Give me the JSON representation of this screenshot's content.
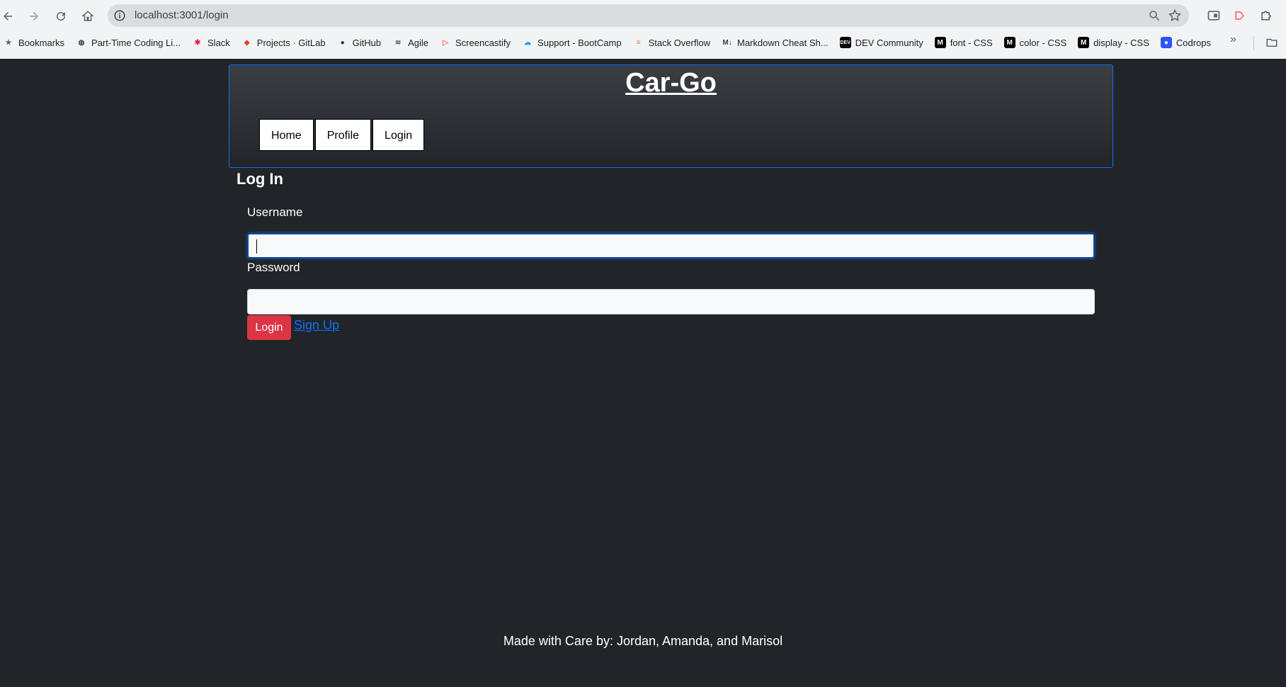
{
  "browser": {
    "url": "localhost:3001/login",
    "bookmarks": [
      {
        "label": "Bookmarks",
        "icon": "star-icon"
      },
      {
        "label": "Part-Time Coding Li...",
        "icon": "globe-icon"
      },
      {
        "label": "Slack",
        "icon": "slack-icon"
      },
      {
        "label": "Projects · GitLab",
        "icon": "gitlab-icon"
      },
      {
        "label": "GitHub",
        "icon": "github-icon"
      },
      {
        "label": "Agile",
        "icon": "agile-icon"
      },
      {
        "label": "Screencastify",
        "icon": "screencastify-icon"
      },
      {
        "label": "Support - BootCamp",
        "icon": "salesforce-icon"
      },
      {
        "label": "Stack Overflow",
        "icon": "stackoverflow-icon"
      },
      {
        "label": "Markdown Cheat Sh...",
        "icon": "markdown-icon"
      },
      {
        "label": "DEV Community",
        "icon": "dev-icon"
      },
      {
        "label": "font - CSS",
        "icon": "mdn-icon"
      },
      {
        "label": "color - CSS",
        "icon": "mdn-icon"
      },
      {
        "label": "display - CSS",
        "icon": "mdn-icon"
      },
      {
        "label": "Codrops",
        "icon": "codrops-icon"
      }
    ],
    "more_label": "»"
  },
  "header": {
    "title": "Car-Go",
    "nav": [
      "Home",
      "Profile",
      "Login"
    ]
  },
  "login": {
    "title": "Log In",
    "username_label": "Username",
    "password_label": "Password",
    "username_value": "",
    "password_value": "",
    "submit_label": "Login",
    "signup_label": "Sign Up"
  },
  "footer": {
    "text": "Made with Care by: Jordan, Amanda, and Marisol"
  },
  "colors": {
    "page_bg": "#212529",
    "header_border": "#0d6efd",
    "login_button": "#dc3545",
    "link": "#0d6efd"
  }
}
